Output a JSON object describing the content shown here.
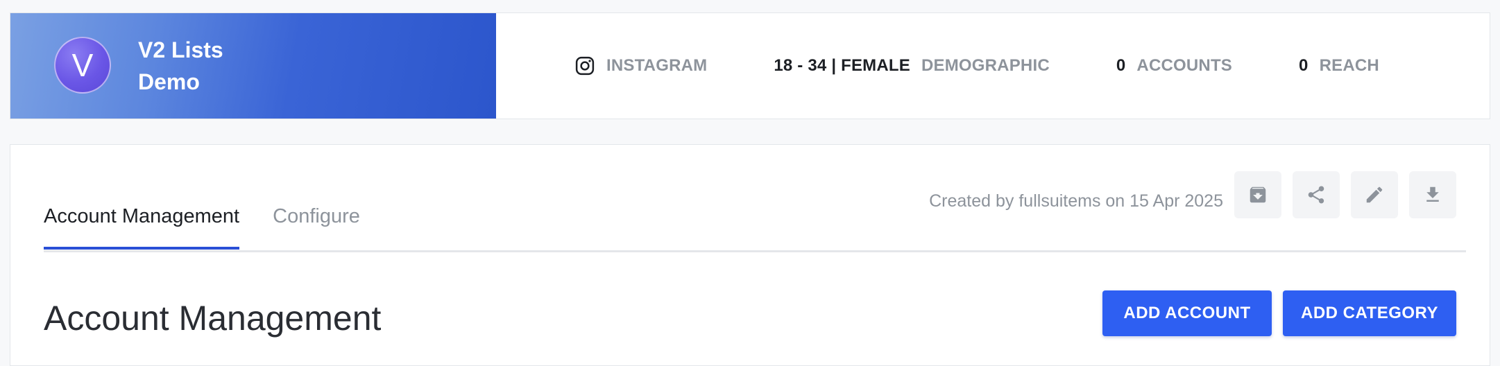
{
  "header": {
    "avatar_letter": "V",
    "list_name_line1": "V2 Lists",
    "list_name_line2": "Demo",
    "platform": {
      "icon": "instagram-icon",
      "label": "INSTAGRAM"
    },
    "demographic": {
      "value": "18 - 34 | FEMALE",
      "label": "DEMOGRAPHIC"
    },
    "accounts": {
      "value": "0",
      "label": "ACCOUNTS"
    },
    "reach": {
      "value": "0",
      "label": "REACH"
    }
  },
  "tabs": [
    {
      "label": "Account Management",
      "active": true
    },
    {
      "label": "Configure",
      "active": false
    }
  ],
  "meta": {
    "created_by": "Created by fullsuitems on 15 Apr 2025"
  },
  "tools": [
    "archive-icon",
    "share-icon",
    "edit-icon",
    "download-icon"
  ],
  "main": {
    "section_title": "Account Management",
    "add_account_label": "ADD ACCOUNT",
    "add_category_label": "ADD CATEGORY"
  },
  "colors": {
    "accent": "#2e5ff2",
    "tab_underline": "#2a4fd6",
    "banner_start": "#7aa0e3",
    "banner_end": "#2c56cc",
    "avatar": "#6a56e6",
    "muted_text": "#8d939b"
  }
}
